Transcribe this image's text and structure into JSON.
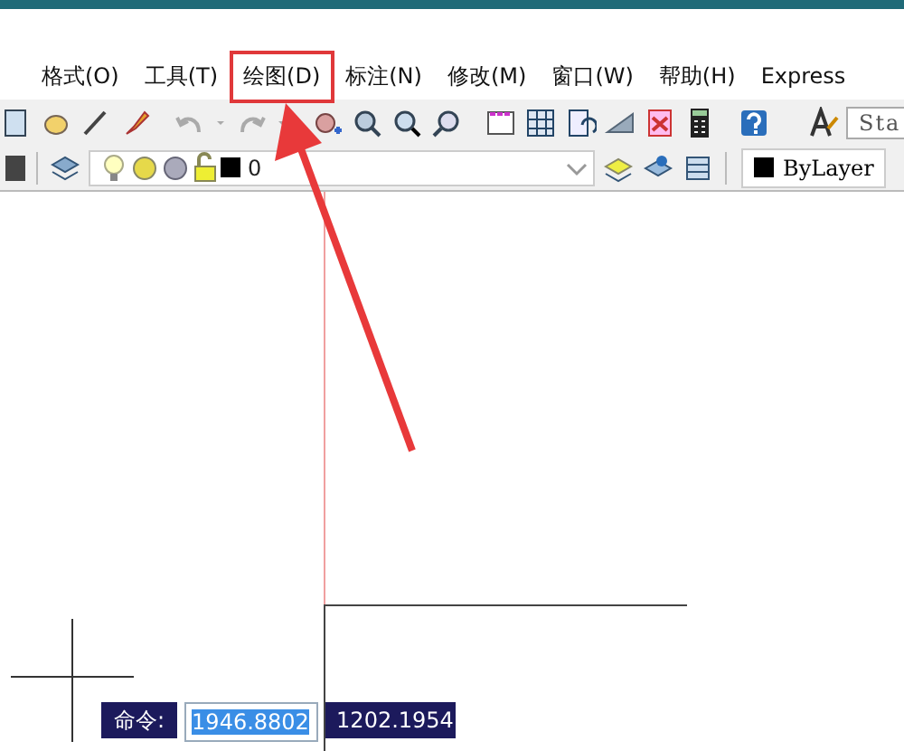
{
  "menu": [
    {
      "label": "格式(O)",
      "highlighted": false
    },
    {
      "label": "工具(T)",
      "highlighted": false
    },
    {
      "label": "绘图(D)",
      "highlighted": true
    },
    {
      "label": "标注(N)",
      "highlighted": false
    },
    {
      "label": "修改(M)",
      "highlighted": false
    },
    {
      "label": "窗口(W)",
      "highlighted": false
    },
    {
      "label": "帮助(H)",
      "highlighted": false
    },
    {
      "label": "Express",
      "highlighted": false
    }
  ],
  "toolbar": {
    "text_style": "Sta"
  },
  "layer_bar": {
    "layer": "0",
    "color_name": "ByLayer"
  },
  "command_tooltip": {
    "label": "命令:",
    "x_value": "1946.8802",
    "x_selected": true,
    "y_value": "1202.1954"
  }
}
